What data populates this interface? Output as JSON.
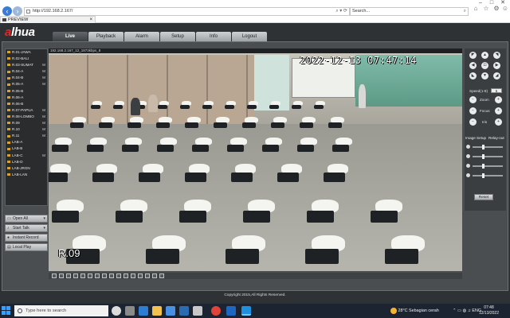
{
  "browser": {
    "url": "http://192.168.2.167/",
    "search_placeholder": "Search...",
    "tab_title": "PREVIEW",
    "tab_close": "×",
    "back_icon": "arrow-left-icon",
    "forward_icon": "arrow-right-icon"
  },
  "app": {
    "logo_main": "a",
    "logo_rest": "lhua",
    "menu": [
      "Live",
      "Playback",
      "Alarm",
      "Setup",
      "Info",
      "Logout"
    ],
    "active_menu": "Live",
    "channels": [
      {
        "label": "R.01-JAWA",
        "flag": ""
      },
      {
        "label": "R.02-BALI",
        "flag": ""
      },
      {
        "label": "R.03-SUMAT",
        "flag": "M"
      },
      {
        "label": "R.04-A",
        "flag": "M"
      },
      {
        "label": "R.04-B",
        "flag": "M"
      },
      {
        "label": "R.05-A",
        "flag": "M"
      },
      {
        "label": "R.05-B",
        "flag": ""
      },
      {
        "label": "R.06-A",
        "flag": ""
      },
      {
        "label": "R.06-B",
        "flag": ""
      },
      {
        "label": "R.07-PAPUA",
        "flag": "M"
      },
      {
        "label": "R.08-LOMBO",
        "flag": "M"
      },
      {
        "label": "R.09",
        "flag": "M"
      },
      {
        "label": "R.10",
        "flag": "M"
      },
      {
        "label": "R.11",
        "flag": "M"
      },
      {
        "label": "LAB-A",
        "flag": ""
      },
      {
        "label": "LAB-B",
        "flag": ""
      },
      {
        "label": "LAB-C",
        "flag": "M"
      },
      {
        "label": "LAB-D",
        "flag": ""
      },
      {
        "label": "LAB-JRGN",
        "flag": ""
      },
      {
        "label": "LAB-LAN",
        "flag": ""
      }
    ],
    "left_buttons": [
      {
        "label": "Open All",
        "icon": "monitor-icon",
        "dropdown": true
      },
      {
        "label": "Start Talk",
        "icon": "microphone-icon",
        "dropdown": true
      },
      {
        "label": "Instant Record",
        "icon": "record-icon",
        "dropdown": false
      },
      {
        "label": "Local Play",
        "icon": "folder-icon",
        "dropdown": false
      }
    ],
    "video": {
      "info": "192.168.2.167_12_1873kbps_8",
      "timestamp": "2022-12-13 07:47:14",
      "room_label": "R.09"
    },
    "ptz": {
      "speed_label": "Speed(1-8)",
      "speed_value": "5",
      "zoom_label": "Zoom",
      "focus_label": "Focus",
      "iris_label": "Iris"
    },
    "image_setup": {
      "tab1": "Image Setup",
      "tab2": "Relay-out",
      "reset_label": "Reset"
    },
    "copyright": "Copyright 2015,All Rights Reserved."
  },
  "taskbar": {
    "search_placeholder": "Type here to search",
    "weather": "28°C  Sebagian cerah",
    "time": "07:48",
    "date": "12/13/2022"
  }
}
